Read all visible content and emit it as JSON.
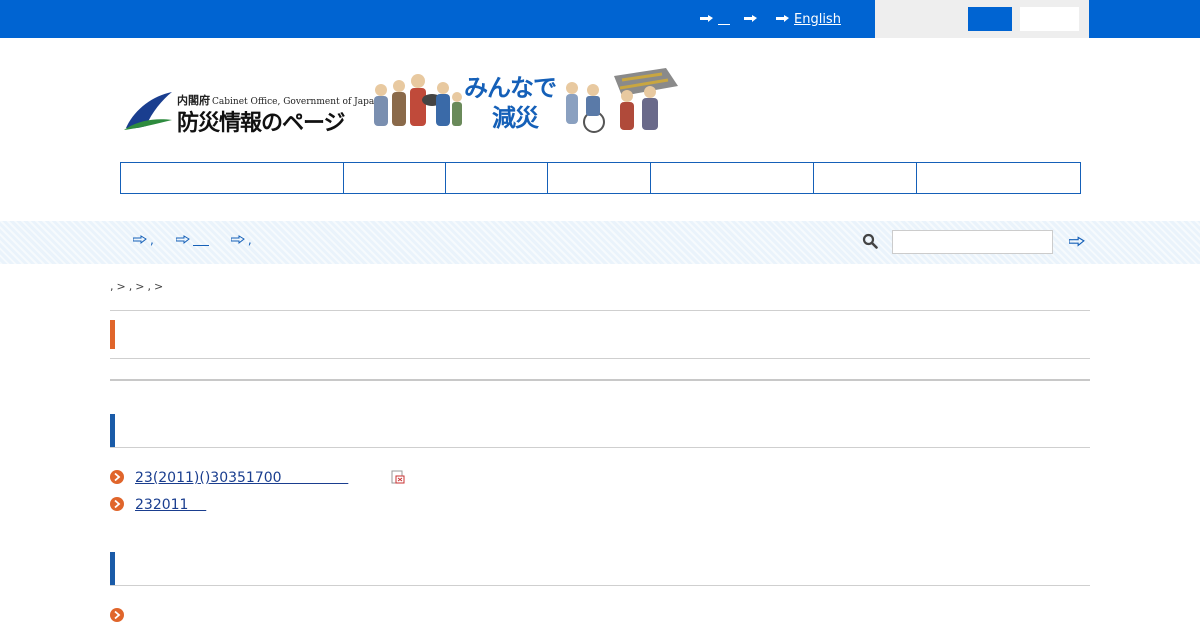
{
  "header": {
    "top_links": [
      {
        "label": "",
        "icon": "pointing-hand-icon"
      },
      {
        "label": "",
        "icon": "pointing-hand-icon"
      },
      {
        "label": "English",
        "icon": "pointing-hand-icon"
      }
    ],
    "colors": {
      "bar": "#0064d2",
      "accent": "#e0652b",
      "section": "#1a5ba8"
    }
  },
  "logo": {
    "org_jp": "内閣府",
    "org_en": "Cabinet Office, Government of Japan",
    "site_name": "防災情報のページ",
    "slogan_line1": "みんなで",
    "slogan_line2": "減災"
  },
  "global_nav": [
    "",
    "",
    "",
    "",
    "",
    "",
    ""
  ],
  "sub_nav": {
    "links": [
      {
        "label": ",",
        "icon": "pointing-hand-icon"
      },
      {
        "label": "",
        "icon": "pointing-hand-icon"
      },
      {
        "label": ",",
        "icon": "pointing-hand-icon"
      }
    ],
    "search": {
      "value": "",
      "placeholder": ""
    }
  },
  "breadcrumb": [
    ",",
    ">",
    ",",
    ">",
    ",",
    ">"
  ],
  "main": {
    "page_title": "",
    "sections": [
      {
        "title": "",
        "links": [
          {
            "label": "23(2011)()30351700               ",
            "pdf": true
          },
          {
            "label": "232011    ",
            "pdf": false
          }
        ]
      },
      {
        "title": "",
        "links": [
          {
            "label": "",
            "pdf": false
          }
        ]
      }
    ]
  }
}
